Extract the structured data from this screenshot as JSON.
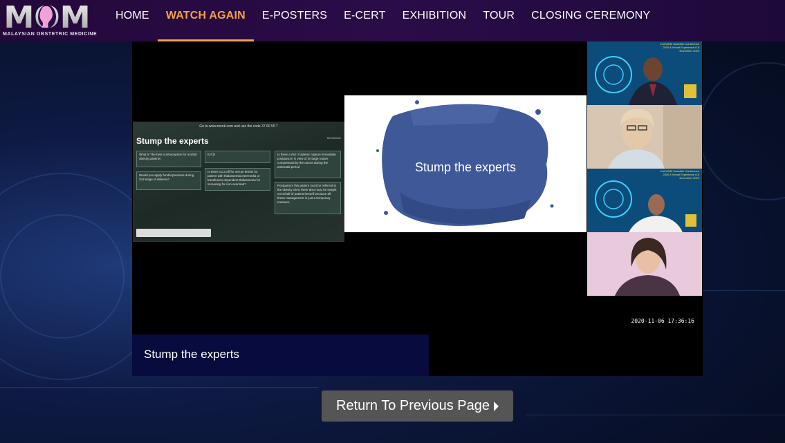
{
  "brand": {
    "logo_text": "MOM",
    "tagline": "MALAYSIAN OBSTETRIC MEDICINE"
  },
  "nav": {
    "items": [
      {
        "label": "HOME",
        "active": false
      },
      {
        "label": "WATCH AGAIN",
        "active": true
      },
      {
        "label": "E-POSTERS",
        "active": false
      },
      {
        "label": "E-CERT",
        "active": false
      },
      {
        "label": "EXHIBITION",
        "active": false
      },
      {
        "label": "TOUR",
        "active": false
      },
      {
        "label": "CLOSING CEREMONY",
        "active": false
      }
    ],
    "active_color": "#f6a04d"
  },
  "video": {
    "shared_screen": {
      "top_line": "Go to www.menti.com and use the code 37 60 59 7",
      "brand": "Mentimeter",
      "title": "Stump the experts",
      "cards": [
        "What is The best contraception for morbid obesity patients",
        "Would you apply fundal pressure during 2nd stage of delivery?",
        "IUCD",
        "Is there a cut off for serum ferritin for patient with thalassemia intermedia or transfusion dependent thalassemia for screening for iron overload?",
        "Is there a risk of splenic rupture immediate postpartum in view of its large nature compressed by the uterus during the antenatal period",
        "Postpartum this patient must be referred to the obesity clinic there also must be insight on behalf of patient herself because all these management is just a temporary measure."
      ]
    },
    "slide": {
      "title": "Stump the experts"
    },
    "participants": [
      {
        "caption": "2nd MOM Scientific Conference 2020 A Virtual Experience 6-8 November 2020"
      },
      {
        "caption": ""
      },
      {
        "caption": "2nd MOM Scientific Conference 2020 A Virtual Experience 6-8 November 2020"
      },
      {
        "caption": ""
      }
    ],
    "timestamp": "2020-11-06 17:36:16"
  },
  "caption": {
    "text": "Stump the experts"
  },
  "return_button": {
    "label": "Return To Previous Page"
  }
}
